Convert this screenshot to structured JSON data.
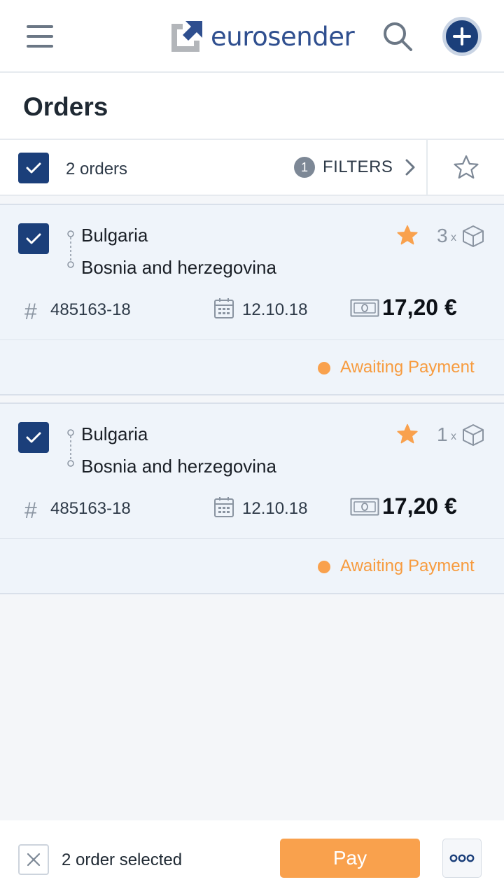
{
  "header": {
    "logo_text": "eurosender"
  },
  "page": {
    "title": "Orders"
  },
  "toolbar": {
    "order_count": "2 orders",
    "filter_count": "1",
    "filters_label": "FILTERS"
  },
  "orders": [
    {
      "from": "Bulgaria",
      "to": "Bosnia and herzegovina",
      "packages": "3",
      "times": "x",
      "order_number": "485163-18",
      "date": "12.10.18",
      "price": "17,20 €",
      "status": "Awaiting Payment",
      "favorite": true,
      "selected": true
    },
    {
      "from": "Bulgaria",
      "to": "Bosnia and herzegovina",
      "packages": "1",
      "times": "x",
      "order_number": "485163-18",
      "date": "12.10.18",
      "price": "17,20 €",
      "status": "Awaiting Payment",
      "favorite": true,
      "selected": true
    }
  ],
  "bottom_bar": {
    "selected_text": "2 order selected",
    "pay_label": "Pay"
  },
  "colors": {
    "brand_blue": "#1b3f7a",
    "accent_orange": "#f9a14d",
    "card_bg": "#eff4fa"
  },
  "icons": {
    "menu": "hamburger-icon",
    "search": "search-icon",
    "add": "plus-icon",
    "check": "check-icon",
    "chevron": "chevron-right-icon",
    "star": "star-icon",
    "box": "box-icon",
    "hash": "hash-icon",
    "calendar": "calendar-icon",
    "money": "money-icon",
    "close": "close-icon",
    "more": "more-icon"
  }
}
